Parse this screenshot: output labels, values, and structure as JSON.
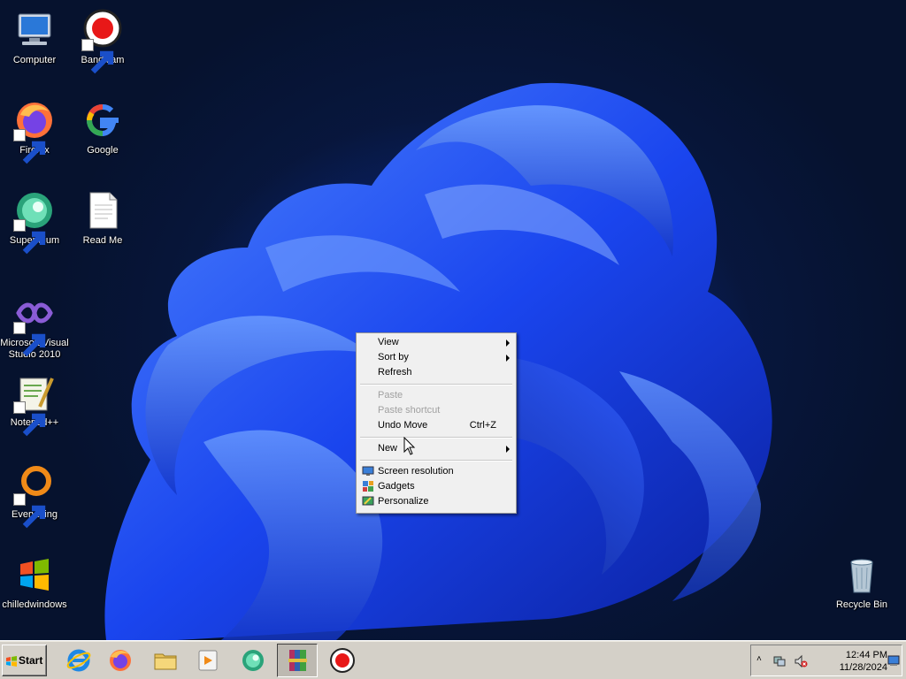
{
  "desktop": {
    "icons": [
      {
        "label": "Computer",
        "icon": "computer-icon"
      },
      {
        "label": "Bandicam",
        "icon": "bandicam-icon"
      },
      {
        "label": "Firefox",
        "icon": "firefox-icon"
      },
      {
        "label": "Google",
        "icon": "google-icon"
      },
      {
        "label": "Supermium",
        "icon": "supermium-icon"
      },
      {
        "label": "Read Me",
        "icon": "text-file-icon"
      },
      {
        "label": "Microsoft Visual Studio 2010",
        "icon": "visual-studio-icon"
      },
      {
        "label": "Notepad++",
        "icon": "notepadpp-icon"
      },
      {
        "label": "Everything",
        "icon": "everything-icon"
      },
      {
        "label": "chilledwindows",
        "icon": "windows-flag-icon"
      },
      {
        "label": "Recycle Bin",
        "icon": "recycle-bin-icon"
      }
    ]
  },
  "context_menu": {
    "view": "View",
    "sort_by": "Sort by",
    "refresh": "Refresh",
    "paste": "Paste",
    "paste_shortcut": "Paste shortcut",
    "undo_move": "Undo Move",
    "undo_move_key": "Ctrl+Z",
    "new": "New",
    "screen_resolution": "Screen resolution",
    "gadgets": "Gadgets",
    "personalize": "Personalize"
  },
  "taskbar": {
    "start_label": "Start",
    "pinned": [
      "internet-explorer-icon",
      "firefox-icon",
      "file-explorer-icon",
      "media-player-icon",
      "supermium-icon",
      "winrar-icon",
      "bandicam-icon"
    ],
    "clock_time": "12:44 PM",
    "clock_date": "11/28/2024"
  },
  "colors": {
    "menu_bg": "#f0f0f0",
    "taskbar_bg": "#d4d0c8",
    "wallpaper_blue": "#1f4dff",
    "desktop_dark": "#06122e"
  }
}
